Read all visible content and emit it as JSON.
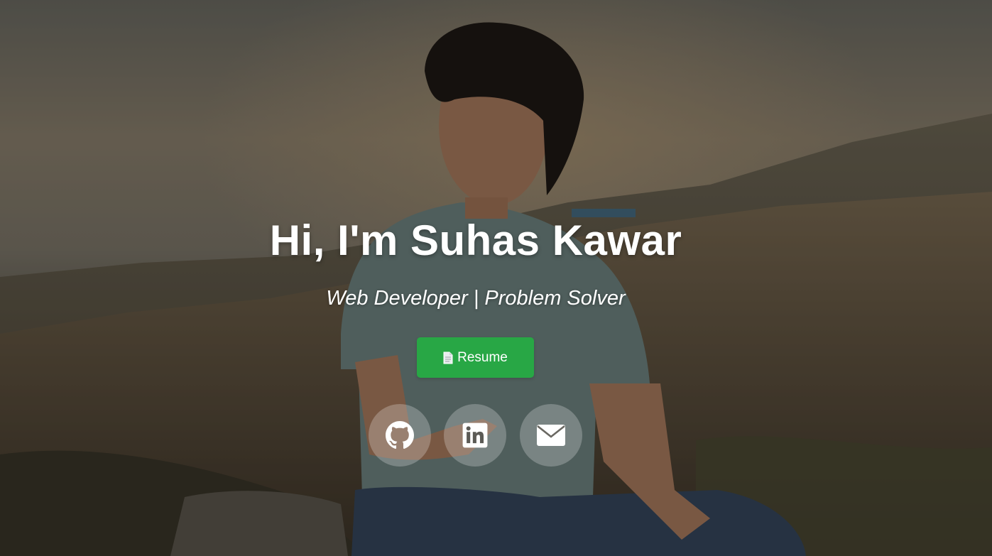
{
  "hero": {
    "title": "Hi, I'm Suhas Kawar",
    "subtitle": "Web Developer | Problem Solver",
    "resume_label": "Resume"
  },
  "social_links": [
    {
      "icon": "github-icon"
    },
    {
      "icon": "linkedin-icon"
    },
    {
      "icon": "email-icon"
    }
  ],
  "colors": {
    "resume_button": "#28a745",
    "text": "#ffffff",
    "social_circle": "rgba(255,255,255,0.24)"
  }
}
